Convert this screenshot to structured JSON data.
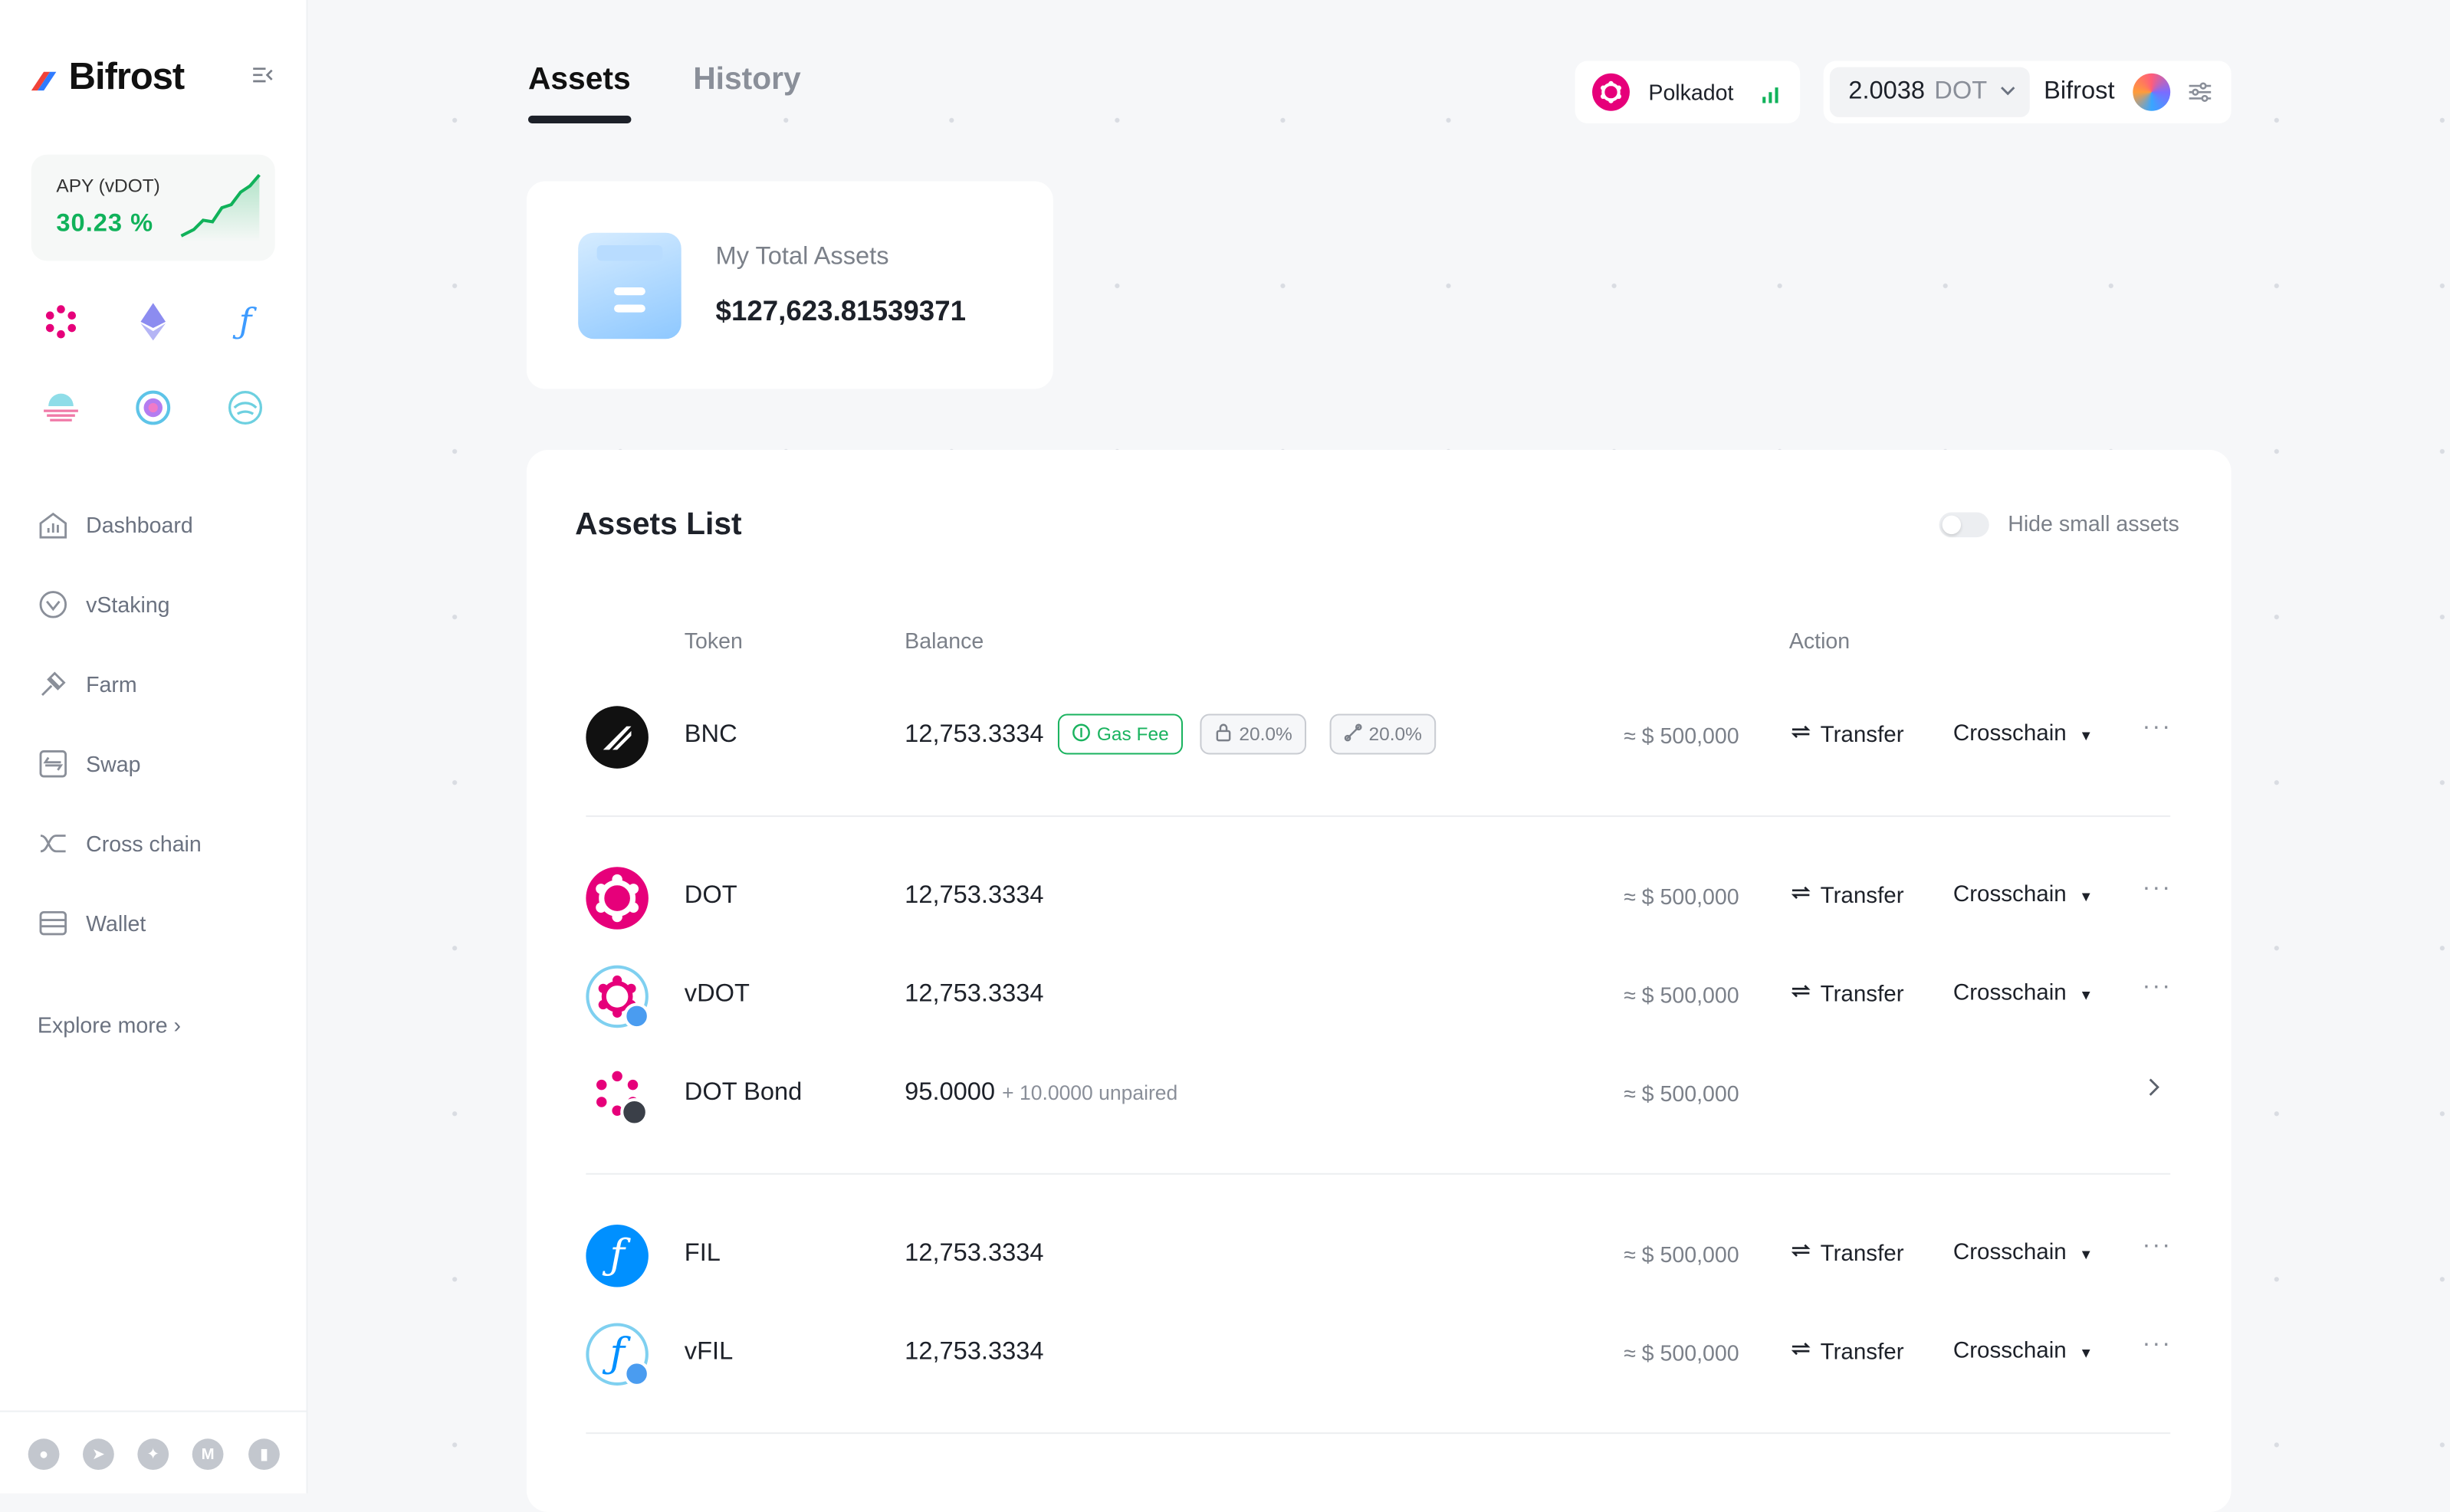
{
  "app": {
    "name": "Bifrost"
  },
  "sidebar": {
    "apy_label": "APY (vDOT)",
    "apy_value": "30.23 %",
    "chains": [
      "polkadot-icon",
      "ethereum-icon",
      "filecoin-icon",
      "moonbeam-icon",
      "astar-icon",
      "kusama-icon"
    ],
    "nav": [
      {
        "label": "Dashboard",
        "icon": "dashboard-icon"
      },
      {
        "label": "vStaking",
        "icon": "vstaking-icon"
      },
      {
        "label": "Farm",
        "icon": "farm-icon"
      },
      {
        "label": "Swap",
        "icon": "swap-icon"
      },
      {
        "label": "Cross chain",
        "icon": "cross-chain-icon"
      },
      {
        "label": "Wallet",
        "icon": "wallet-icon"
      }
    ],
    "explore": "Explore more ›",
    "socials": [
      "github-icon",
      "telegram-icon",
      "twitter-icon",
      "medium-icon",
      "analytics-icon"
    ]
  },
  "header": {
    "tabs": [
      {
        "label": "Assets",
        "active": true
      },
      {
        "label": "History",
        "active": false
      }
    ],
    "network": "Polkadot",
    "balance_value": "2.0038",
    "balance_unit": "DOT",
    "account": "Bifrost"
  },
  "total": {
    "label": "My Total Assets",
    "value": "$127,623.81539371"
  },
  "assets": {
    "title": "Assets List",
    "hide_small": "Hide small assets",
    "columns": {
      "token": "Token",
      "balance": "Balance",
      "action": "Action"
    },
    "transfer_label": "Transfer",
    "crosschain_label": "Crosschain",
    "rows": [
      {
        "token": "BNC",
        "balance": "12,753.3334",
        "usd": "≈ $ 500,000",
        "gas": "Gas Fee",
        "lock": "20.0%",
        "link": "20.0%"
      },
      {
        "token": "DOT",
        "balance": "12,753.3334",
        "usd": "≈ $ 500,000"
      },
      {
        "token": "vDOT",
        "balance": "12,753.3334",
        "usd": "≈ $ 500,000"
      },
      {
        "token": "DOT Bond",
        "balance": "95.0000",
        "unpaired": "+ 10.0000 unpaired",
        "usd": "≈ $ 500,000"
      },
      {
        "token": "FIL",
        "balance": "12,753.3334",
        "usd": "≈ $ 500,000"
      },
      {
        "token": "vFIL",
        "balance": "12,753.3334",
        "usd": "≈ $ 500,000"
      }
    ]
  },
  "colors": {
    "accent_green": "#10b25a",
    "polkadot_pink": "#e6007a",
    "filecoin_blue": "#0090ff"
  }
}
